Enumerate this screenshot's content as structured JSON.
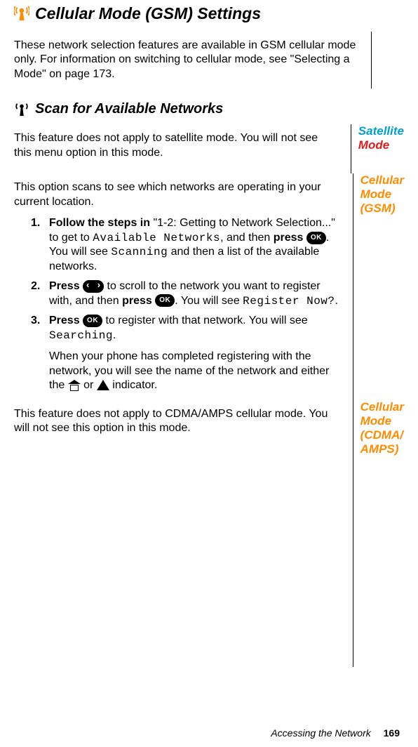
{
  "title": "Cellular Mode (GSM) Settings",
  "intro": "These network selection features are available in GSM cellular mode only. For information on switching to cellular mode, see \"Selecting a Mode\" on page 173.",
  "sub1": {
    "heading": "Scan for Available Networks",
    "satellite_note": "This feature does not apply to satellite mode. You will not see this menu option in this mode.",
    "gsm_intro": "This option scans to see which networks are operating in your current location.",
    "steps": {
      "s1": {
        "num": "1.",
        "lead": "Follow the steps in ",
        "ref": "\"1-2: Getting to Network Selection...\" to get to ",
        "disp1": "Available Networks",
        "mid": ", and then ",
        "press": "press ",
        "after_ok": ". You will see ",
        "disp2": "Scanning",
        "tail": " and then a list of the available networks."
      },
      "s2": {
        "num": "2.",
        "press1": "Press ",
        "mid": " to scroll to the network you want to register with, and then ",
        "press2": "press ",
        "after_ok": ". You will see ",
        "disp": "Register Now?",
        "tail": "."
      },
      "s3": {
        "num": "3.",
        "press": "Press ",
        "mid": " to register with that network. You will see ",
        "disp": "Searching",
        "tail": ".",
        "result_a": "When your phone has completed registering with the network, you will see the name of the network and either the ",
        "or": " or ",
        "result_b": " indicator."
      }
    },
    "cdma_note": "This feature does not apply to CDMA/AMPS cellular mode. You will not see this option in this mode."
  },
  "side": {
    "satellite": {
      "w1": "Satellite",
      "w2": "Mode"
    },
    "gsm": {
      "w1": "Cellular",
      "w2": "Mode",
      "w3": "(GSM)"
    },
    "cdma": {
      "w1": "Cellular",
      "w2": "Mode",
      "w3": "(CDMA/",
      "w4": "AMPS)"
    }
  },
  "ok_label": "OK",
  "footer": {
    "chapter": "Accessing the Network",
    "page": "169"
  }
}
